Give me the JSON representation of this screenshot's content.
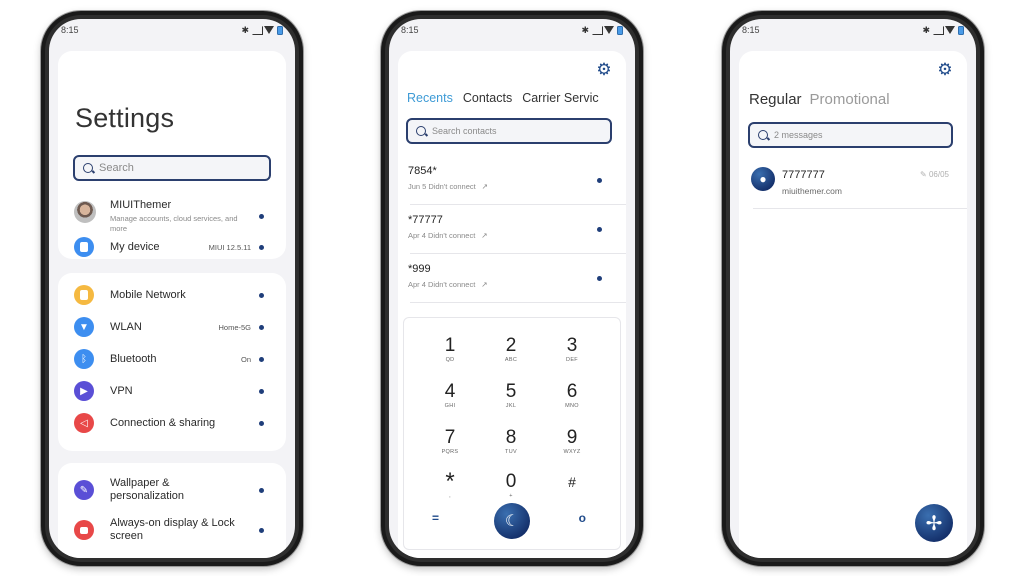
{
  "status_bar": {
    "time": "8:15",
    "bluetooth_glyph": "✱"
  },
  "settings": {
    "title": "Settings",
    "search_placeholder": "Search",
    "account": {
      "name": "MIUIThemer",
      "subtitle": "Manage accounts, cloud services, and more"
    },
    "groups": [
      [
        {
          "label": "My device",
          "value": "MIUI 12.5.11",
          "icon": "phone-icon",
          "color": "#3d8ef0"
        }
      ],
      [
        {
          "label": "Mobile Network",
          "value": "",
          "icon": "sim-icon",
          "color": "#f5b941"
        },
        {
          "label": "WLAN",
          "value": "Home-5G",
          "icon": "wifi-icon",
          "color": "#3d8ef0"
        },
        {
          "label": "Bluetooth",
          "value": "On",
          "icon": "bluetooth-icon",
          "color": "#3d8ef0"
        },
        {
          "label": "VPN",
          "value": "",
          "icon": "vpn-icon",
          "color": "#5a4fd6"
        },
        {
          "label": "Connection & sharing",
          "value": "",
          "icon": "share-icon",
          "color": "#e84848"
        }
      ],
      [
        {
          "label": "Wallpaper & personalization",
          "value": "",
          "icon": "brush-icon",
          "color": "#5a4fd6"
        },
        {
          "label": "Always-on display & Lock screen",
          "value": "",
          "icon": "lock-icon",
          "color": "#e84848"
        }
      ]
    ]
  },
  "dialer": {
    "tabs": [
      "Recents",
      "Contacts",
      "Carrier Servic"
    ],
    "active_tab": "Recents",
    "search_placeholder": "Search contacts",
    "calls": [
      {
        "number": "7854*",
        "meta": "Jun 5 Didn't connect"
      },
      {
        "number": "*77777",
        "meta": "Apr 4 Didn't connect"
      },
      {
        "number": "*999",
        "meta": "Apr 4 Didn't connect"
      }
    ],
    "keys": [
      {
        "digit": "1",
        "letters": "QD"
      },
      {
        "digit": "2",
        "letters": "ABC"
      },
      {
        "digit": "3",
        "letters": "DEF"
      },
      {
        "digit": "4",
        "letters": "GHI"
      },
      {
        "digit": "5",
        "letters": "JKL"
      },
      {
        "digit": "6",
        "letters": "MNO"
      },
      {
        "digit": "7",
        "letters": "PQRS"
      },
      {
        "digit": "8",
        "letters": "TUV"
      },
      {
        "digit": "9",
        "letters": "WXYZ"
      },
      {
        "digit": "*",
        "letters": ","
      },
      {
        "digit": "0",
        "letters": "+"
      },
      {
        "digit": "#",
        "letters": ""
      }
    ],
    "call_glyph": "☾",
    "menu_glyph": "=",
    "hide_glyph": "o"
  },
  "messages": {
    "tabs": [
      "Regular",
      "Promotional"
    ],
    "active_tab": "Regular",
    "search_placeholder": "2 messages",
    "threads": [
      {
        "name": "7777777",
        "preview": "miuithemer.com",
        "date": "06/05"
      }
    ],
    "draft_glyph": "✎",
    "compose_glyph": "✢"
  },
  "accent_colors": {
    "navy": "#1f3e7a",
    "tab_active_blue": "#3e9bd6"
  }
}
